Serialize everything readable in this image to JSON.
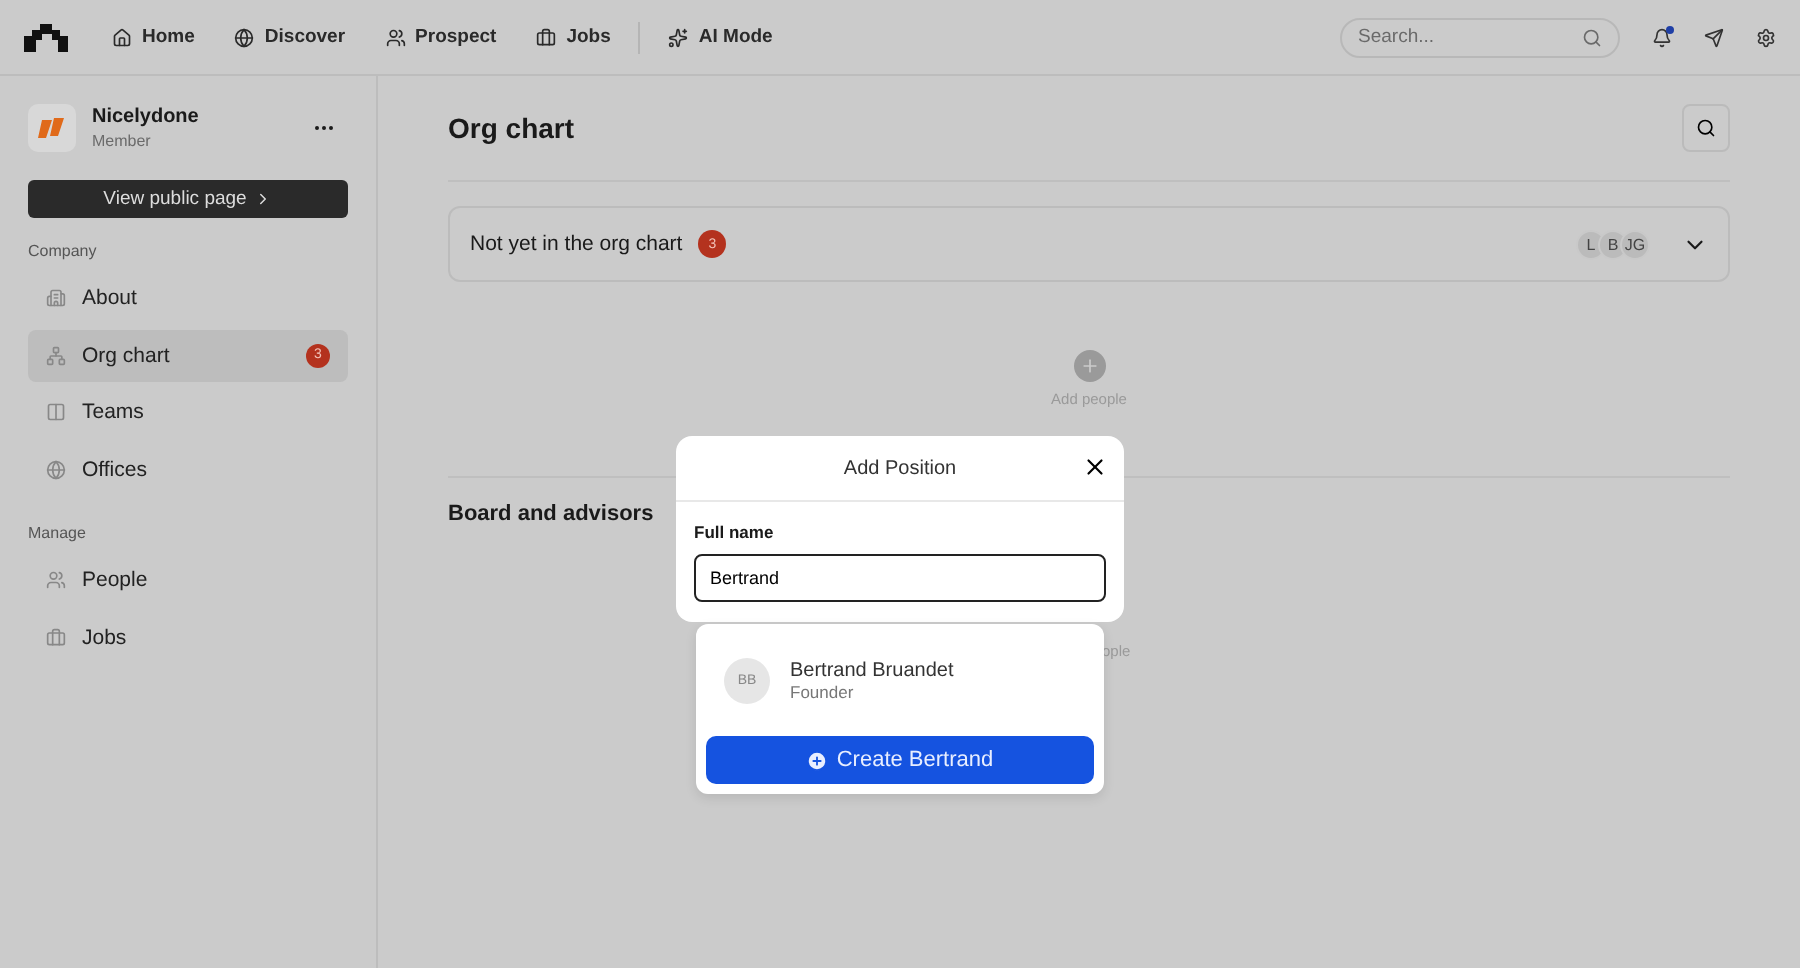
{
  "nav": {
    "items": [
      {
        "label": "Home"
      },
      {
        "label": "Discover"
      },
      {
        "label": "Prospect"
      },
      {
        "label": "Jobs"
      },
      {
        "label": "AI Mode"
      }
    ],
    "search": {
      "placeholder": "Search..."
    },
    "notifications": true
  },
  "sidebar": {
    "org": {
      "name": "Nicelydone",
      "role": "Member"
    },
    "public_button": "View public page",
    "sections": [
      {
        "title": "Company",
        "items": [
          {
            "label": "About",
            "selected": false
          },
          {
            "label": "Org chart",
            "selected": true,
            "badge": "3"
          },
          {
            "label": "Teams",
            "selected": false
          },
          {
            "label": "Offices",
            "selected": false
          }
        ]
      },
      {
        "title": "Manage",
        "items": [
          {
            "label": "People",
            "selected": false
          },
          {
            "label": "Jobs",
            "selected": false
          }
        ]
      }
    ]
  },
  "page": {
    "title": "Org chart",
    "pending": {
      "label": "Not yet in the org chart",
      "count": "3",
      "avatars": [
        "L",
        "B",
        "JG"
      ]
    },
    "add_people": "Add people",
    "board_title": "Board and advisors",
    "board_add_people_visible": "ople"
  },
  "dialog": {
    "title": "Add Position",
    "field_label": "Full name",
    "value": "Bertrand",
    "suggestions": [
      {
        "initials": "BB",
        "name": "Bertrand Bruandet",
        "role": "Founder"
      }
    ],
    "create_button": "Create Bertrand"
  }
}
